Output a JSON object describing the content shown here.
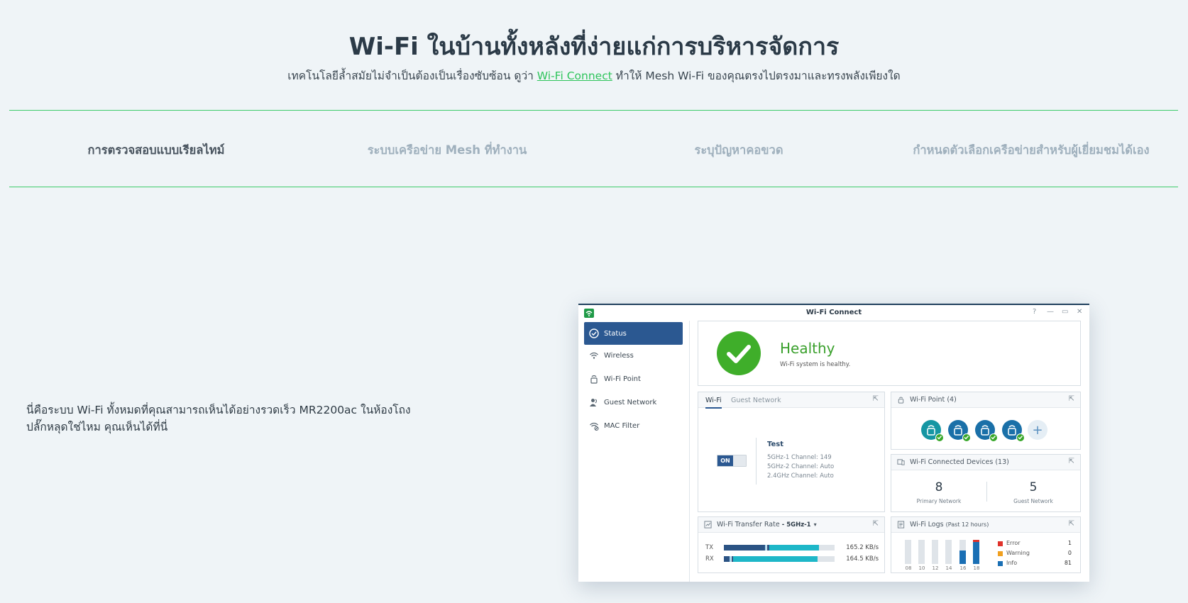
{
  "hero": {
    "title": "Wi-Fi ในบ้านทั้งหลังที่ง่ายแก่การบริหารจัดการ",
    "sub_before": "เทคโนโลยีล้ำสมัยไม่จำเป็นต้องเป็นเรื่องซับซ้อน ดูว่า ",
    "sub_link": "Wi-Fi Connect",
    "sub_after": " ทำให้ Mesh Wi-Fi ของคุณตรงไปตรงมาและทรงพลังเพียงใด"
  },
  "tabs": [
    {
      "label": "การตรวจสอบแบบเรียลไทม์"
    },
    {
      "label": "ระบบเครือข่าย Mesh ที่ทำงาน"
    },
    {
      "label": "ระบุปัญหาคอขวด"
    },
    {
      "label": "กำหนดตัวเลือกเครือข่ายสำหรับผู้เยี่ยมชมได้เอง"
    }
  ],
  "description": "นี่คือระบบ Wi-Fi ทั้งหมดที่คุณสามารถเห็นได้อย่างรวดเร็ว MR2200ac ในห้องโถงปลั๊กหลุดใช่ไหม คุณเห็นได้ที่นี่",
  "window": {
    "title": "Wi-Fi Connect",
    "controls": [
      "?",
      "—",
      "▭",
      "✕"
    ],
    "sidebar": [
      {
        "label": "Status",
        "icon": "status-icon"
      },
      {
        "label": "Wireless",
        "icon": "wireless-icon"
      },
      {
        "label": "Wi-Fi Point",
        "icon": "wifi-point-icon"
      },
      {
        "label": "Guest Network",
        "icon": "guest-network-icon"
      },
      {
        "label": "MAC Filter",
        "icon": "mac-filter-icon"
      }
    ],
    "health": {
      "title": "Healthy",
      "sub": "Wi-Fi system is healthy."
    },
    "wifi": {
      "tab1": "Wi-Fi",
      "tab2": "Guest Network",
      "toggle": "ON",
      "ssid": "Test",
      "channels": [
        "5GHz-1 Channel: 149",
        "5GHz-2 Channel: Auto",
        "2.4GHz Channel: Auto"
      ]
    },
    "point": {
      "title": "Wi-Fi Point",
      "count": "(4)"
    },
    "devices": {
      "title": "Wi-Fi Connected Devices",
      "count": "(13)",
      "primary_value": "8",
      "primary_label": "Primary Network",
      "guest_value": "5",
      "guest_label": "Guest Network"
    },
    "rate": {
      "title": "Wi-Fi Transfer Rate",
      "band": "- 5GHz-1",
      "tx_label": "TX",
      "tx_value": "165.2 KB/s",
      "rx_label": "RX",
      "rx_value": "164.5 KB/s"
    },
    "logs": {
      "title": "Wi-Fi Logs",
      "range": "(Past 12 hours)",
      "hours": [
        "08",
        "10",
        "12",
        "14",
        "16",
        "18"
      ],
      "error_label": "Error",
      "error_value": "1",
      "warning_label": "Warning",
      "warning_value": "0",
      "info_label": "Info",
      "info_value": "81"
    },
    "colors": {
      "accent": "#2b5891",
      "healthy": "#3fae2a",
      "link": "#2ec45b",
      "error": "#e0322a",
      "warning": "#f0a020",
      "info": "#1a6fb4"
    }
  }
}
